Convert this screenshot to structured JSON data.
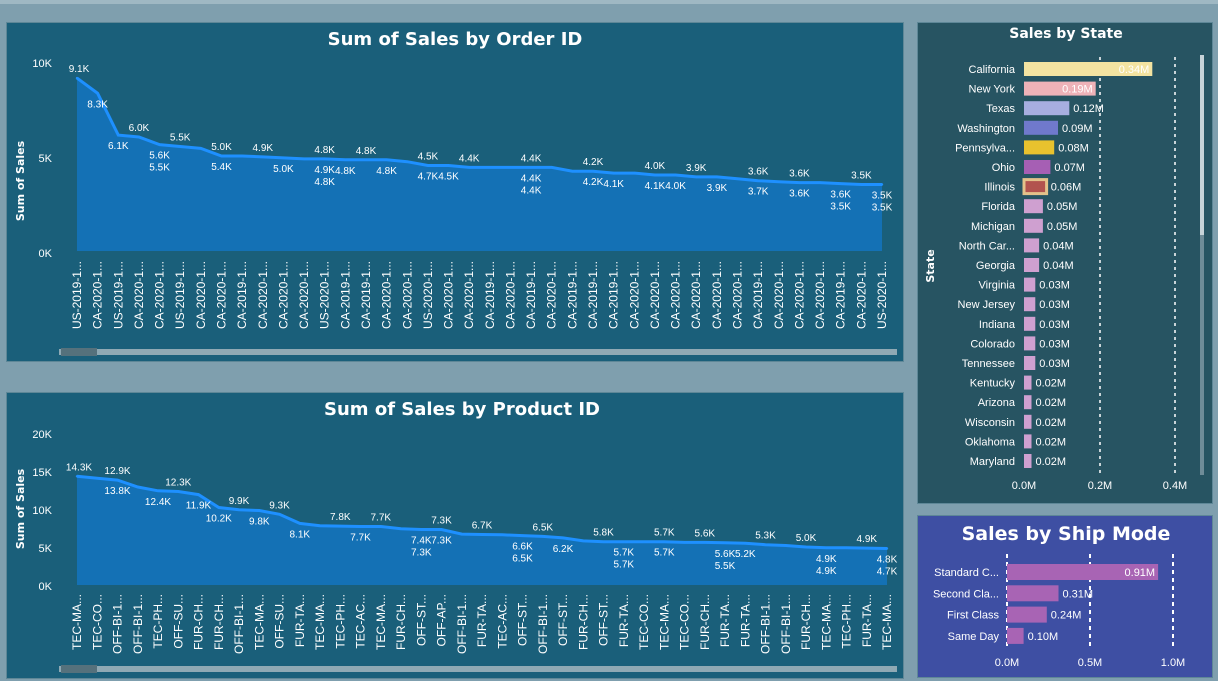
{
  "colors": {
    "background": "#7f9fae",
    "panel": "#1a5f7a",
    "state_panel": "#275462",
    "ship_panel": "#3e4fa3",
    "area_fill": "#1471b5",
    "line": "#1e90ff"
  },
  "charts": {
    "order": {
      "title": "Sum of Sales by Order ID",
      "ylabel": "Sum of Sales",
      "yticks": [
        "10K",
        "5K",
        "0K"
      ],
      "categories": [
        "US-2019-1...",
        "CA-2020-1...",
        "US-2019-1...",
        "CA-2020-1...",
        "CA-2020-1...",
        "US-2019-1...",
        "CA-2020-1...",
        "CA-2020-1...",
        "CA-2019-1...",
        "CA-2020-1...",
        "CA-2020-1...",
        "CA-2020-1...",
        "US-2020-1...",
        "CA-2019-1...",
        "CA-2019-1...",
        "CA-2020-1...",
        "CA-2020-1...",
        "US-2020-1...",
        "CA-2020-1...",
        "CA-2020-1...",
        "CA-2019-1...",
        "CA-2020-1...",
        "CA-2019-1...",
        "CA-2020-1...",
        "CA-2019-1...",
        "CA-2019-1...",
        "CA-2019-1...",
        "CA-2020-1...",
        "CA-2020-1...",
        "CA-2020-1...",
        "CA-2020-1...",
        "CA-2020-1...",
        "CA-2020-1...",
        "CA-2019-1...",
        "CA-2020-1...",
        "CA-2020-1...",
        "CA-2020-1...",
        "CA-2019-1...",
        "CA-2020-1...",
        "US-2020-1..."
      ],
      "labels_above": [
        "9.1K",
        "",
        "",
        "6.0K",
        "",
        "5.5K",
        "",
        "5.0K",
        "",
        "4.9K",
        "",
        "",
        "4.8K",
        "",
        "4.8K",
        "",
        "",
        "4.5K",
        "",
        "4.4K",
        "",
        "",
        "4.4K",
        "",
        "",
        "4.2K",
        "",
        "",
        "4.0K",
        "",
        "3.9K",
        "",
        "",
        "3.6K",
        "",
        "3.6K",
        "",
        "",
        "3.5K",
        ""
      ],
      "labels_below": [
        "",
        "8.3K",
        "6.1K",
        "",
        "5.6K / 5.5K",
        "",
        "",
        "5.4K",
        "",
        "",
        "5.0K",
        "",
        "4.9K / 4.8K",
        "4.8K",
        "",
        "4.8K",
        "",
        "4.7K",
        "4.5K",
        "",
        "",
        "",
        "4.4K / 4.4K",
        "",
        "",
        "4.2K",
        "4.1K",
        "",
        "4.1K",
        "4.0K",
        "",
        "3.9K",
        "",
        "3.7K",
        "",
        "3.6K",
        "",
        "3.6K / 3.5K",
        "",
        "3.5K / 3.5K"
      ]
    },
    "product": {
      "title": "Sum of Sales by Product ID",
      "ylabel": "Sum of Sales",
      "yticks": [
        "20K",
        "15K",
        "10K",
        "5K",
        "0K"
      ],
      "categories": [
        "TEC-MA...",
        "TEC-CO...",
        "OFF-BI-1...",
        "OFF-BI-1...",
        "TEC-PH...",
        "OFF-SU...",
        "FUR-CH...",
        "FUR-CH...",
        "OFF-BI-1...",
        "TEC-MA...",
        "OFF-SU...",
        "FUR-TA...",
        "TEC-MA...",
        "TEC-PH...",
        "TEC-AC...",
        "TEC-MA...",
        "FUR-CH...",
        "OFF-ST...",
        "OFF-AP...",
        "OFF-BI-1...",
        "FUR-TA...",
        "TEC-AC...",
        "OFF-ST...",
        "OFF-BI-1...",
        "OFF-ST...",
        "FUR-CH...",
        "OFF-ST...",
        "FUR-TA...",
        "TEC-CO...",
        "TEC-MA...",
        "TEC-CO...",
        "FUR-CH...",
        "FUR-TA...",
        "FUR-TA...",
        "OFF-BI-1...",
        "OFF-BI-1...",
        "FUR-CH...",
        "TEC-MA...",
        "TEC-PH...",
        "FUR-TA...",
        "TEC-MA..."
      ],
      "labels_above": [
        "14.3K",
        "",
        "12.9K",
        "",
        "",
        "12.3K",
        "",
        "",
        "9.9K",
        "",
        "9.3K",
        "",
        "",
        "7.8K",
        "",
        "7.7K",
        "",
        "",
        "7.3K",
        "",
        "6.7K",
        "",
        "",
        "6.5K",
        "",
        "",
        "5.8K",
        "",
        "",
        "5.7K",
        "",
        "5.6K",
        "",
        "",
        "5.3K",
        "",
        "5.0K",
        "",
        "",
        "4.9K",
        ""
      ],
      "labels_below": [
        "",
        "",
        "13.8K",
        "",
        "12.4K",
        "",
        "11.9K",
        "10.2K",
        "",
        "9.8K",
        "",
        "8.1K",
        "",
        "",
        "7.7K",
        "",
        "",
        "7.4K / 7.3K",
        "7.3K",
        "",
        "",
        "",
        "6.6K / 6.5K",
        "",
        "6.2K",
        "",
        "",
        "5.7K / 5.7K",
        "",
        "5.7K",
        "",
        "",
        "5.6K / 5.5K",
        "5.2K",
        "",
        "",
        "",
        "4.9K / 4.9K",
        "",
        "",
        "4.8K / 4.7K"
      ]
    },
    "state": {
      "title": "Sales by State",
      "axis_title": "State",
      "xticks": [
        "0.0M",
        "0.2M",
        "0.4M"
      ]
    },
    "ship": {
      "title": "Sales by Ship Mode",
      "xticks": [
        "0.0M",
        "0.5M",
        "1.0M"
      ]
    }
  },
  "chart_data": [
    {
      "type": "area",
      "title": "Sum of Sales by Order ID",
      "ylabel": "Sum of Sales",
      "ylim": [
        0,
        10000
      ],
      "y": [
        9100,
        8300,
        6100,
        6000,
        5600,
        5500,
        5400,
        5000,
        5000,
        4950,
        4900,
        4850,
        4850,
        4800,
        4800,
        4800,
        4700,
        4500,
        4500,
        4400,
        4400,
        4400,
        4400,
        4400,
        4200,
        4200,
        4100,
        4100,
        4000,
        4000,
        3900,
        3900,
        3800,
        3700,
        3650,
        3600,
        3600,
        3550,
        3500,
        3500
      ]
    },
    {
      "type": "area",
      "title": "Sum of Sales by Product ID",
      "ylabel": "Sum of Sales",
      "ylim": [
        0,
        20000
      ],
      "y": [
        14300,
        14050,
        13800,
        12900,
        12400,
        12300,
        11900,
        10200,
        9900,
        9800,
        9300,
        8100,
        7800,
        7750,
        7700,
        7700,
        7400,
        7300,
        7300,
        6700,
        6650,
        6600,
        6500,
        6400,
        6200,
        5800,
        5700,
        5700,
        5700,
        5700,
        5600,
        5600,
        5550,
        5500,
        5300,
        5200,
        5000,
        4900,
        4900,
        4850,
        4800
      ]
    },
    {
      "type": "bar",
      "title": "Sales by State",
      "ylabel": "State",
      "xlim": [
        0,
        0.4
      ],
      "categories": [
        "California",
        "New York",
        "Texas",
        "Washington",
        "Pennsylva...",
        "Ohio",
        "Illinois",
        "Florida",
        "Michigan",
        "North Car...",
        "Georgia",
        "Virginia",
        "New Jersey",
        "Indiana",
        "Colorado",
        "Tennessee",
        "Kentucky",
        "Arizona",
        "Wisconsin",
        "Oklahoma",
        "Maryland"
      ],
      "values": [
        0.34,
        0.19,
        0.12,
        0.09,
        0.08,
        0.07,
        0.06,
        0.05,
        0.05,
        0.04,
        0.04,
        0.03,
        0.03,
        0.03,
        0.03,
        0.03,
        0.02,
        0.02,
        0.02,
        0.02,
        0.02
      ],
      "value_labels": [
        "0.34M",
        "0.19M",
        "0.12M",
        "0.09M",
        "0.08M",
        "0.07M",
        "0.06M",
        "0.05M",
        "0.05M",
        "0.04M",
        "0.04M",
        "0.03M",
        "0.03M",
        "0.03M",
        "0.03M",
        "0.03M",
        "0.02M",
        "0.02M",
        "0.02M",
        "0.02M",
        "0.02M"
      ],
      "colors": [
        "#f3e3a1",
        "#eeb2b8",
        "#a7aee0",
        "#7079cc",
        "#e8c22e",
        "#a65fb4",
        "#b2534e",
        "#cfa0d0",
        "#cfa0d0",
        "#cfa0d0",
        "#cfa0d0",
        "#cfa0d0",
        "#cfa0d0",
        "#cfa0d0",
        "#cfa0d0",
        "#cfa0d0",
        "#cfa0d0",
        "#cfa0d0",
        "#cfa0d0",
        "#cfa0d0",
        "#cfa0d0"
      ]
    },
    {
      "type": "bar",
      "title": "Sales by Ship Mode",
      "xlim": [
        0,
        1.0
      ],
      "categories": [
        "Standard C...",
        "Second Cla...",
        "First Class",
        "Same Day"
      ],
      "values": [
        0.91,
        0.31,
        0.24,
        0.1
      ],
      "value_labels": [
        "0.91M",
        "0.31M",
        "0.24M",
        "0.10M"
      ],
      "color": "#a864b4"
    }
  ]
}
